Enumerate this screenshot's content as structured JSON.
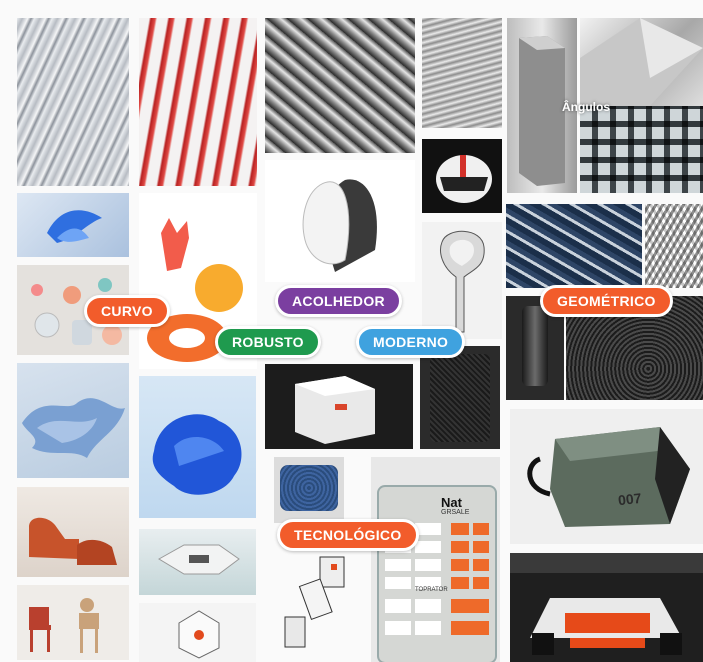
{
  "labels": {
    "curvo": "CURVO",
    "acolhedor": "ACOLHEDOR",
    "robusto": "ROBUSTO",
    "moderno": "MODERNO",
    "geometrico": "GEOMÉTRICO",
    "tecnologico": "TECNOLÓGICO",
    "angulos": "Ângulos"
  },
  "colors": {
    "orange": "#f25c2b",
    "purple": "#7b3fa0",
    "green": "#1f9a4e",
    "blue": "#3fa2df"
  },
  "keypad": {
    "brand": "Nat",
    "subtitle": "GRSALE",
    "key_label": "TOPRATOR"
  },
  "product_mark": "007"
}
